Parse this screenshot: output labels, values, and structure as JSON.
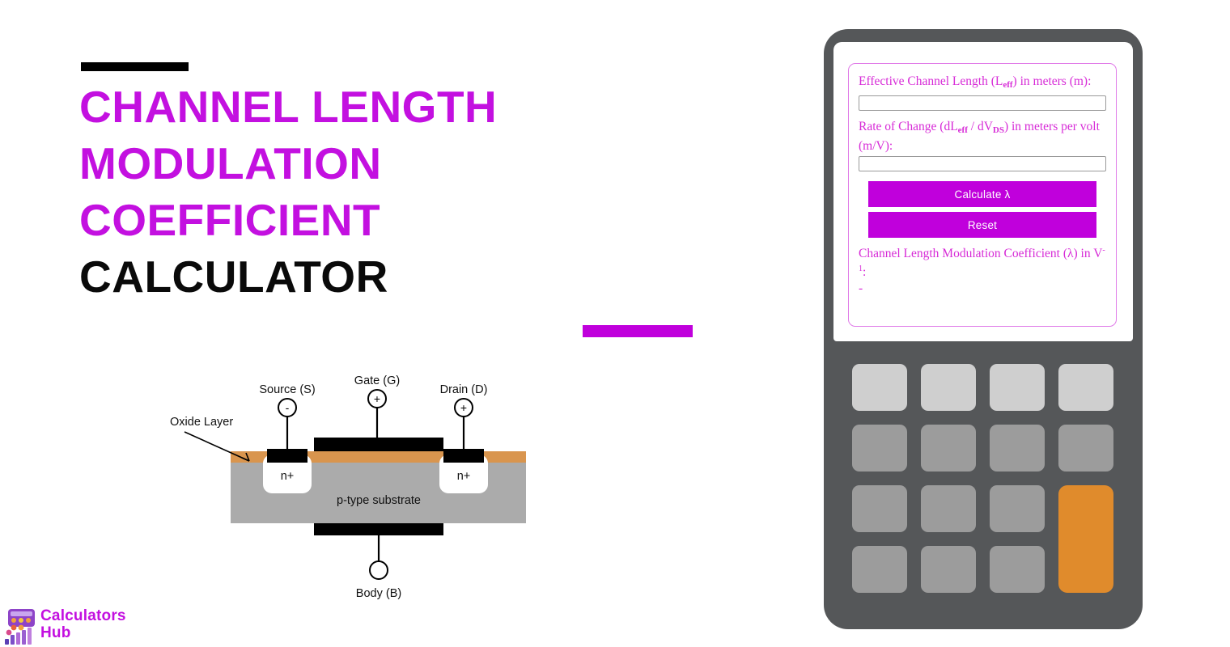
{
  "hero": {
    "title_line1": "CHANNEL LENGTH",
    "title_line2": "MODULATION",
    "title_line3": "COEFFICIENT",
    "title_line4": "CALCULATOR",
    "accent_purple": "#C310E0",
    "accent_black": "#000000"
  },
  "diagram": {
    "name": "mosfet-cross-section",
    "labels": {
      "oxide_layer": "Oxide Layer",
      "source": "Source (S)",
      "gate": "Gate (G)",
      "drain": "Drain (D)",
      "body": "Body (B)",
      "substrate": "p-type substrate",
      "n_plus_left": "n+",
      "n_plus_right": "n+",
      "source_sign": "-",
      "gate_sign": "+",
      "drain_sign": "+"
    },
    "colors": {
      "oxide": "#D9954E",
      "substrate": "#ABABAB",
      "electrode": "#000000",
      "well": "#FFFFFF"
    }
  },
  "logo": {
    "text_line1": "Calculators",
    "text_line2": "Hub",
    "icon": "calculator-bars-icon",
    "color": "#C310E0"
  },
  "calculator": {
    "frame_color": "#555759",
    "screen_color": "#FFFFFF",
    "form": {
      "field1": {
        "label_pre": "Effective Channel Length (L",
        "label_sub": "eff",
        "label_post": ") in meters (m):",
        "value": "",
        "placeholder": ""
      },
      "field2": {
        "label_p1": "Rate of Change (dL",
        "label_sub1": "eff",
        "label_p2": " / dV",
        "label_sub2": "DS",
        "label_p3": ") in meters per volt (m/V):",
        "value": "",
        "placeholder": ""
      },
      "calculate_label": "Calculate λ",
      "reset_label": "Reset",
      "result_label_pre": "Channel Length Modulation Coefficient (λ) in V",
      "result_label_sup": "-1",
      "result_label_post": ":",
      "result_value": "-",
      "button_color": "#C000DC",
      "label_color": "#D72BD7"
    },
    "keypad": {
      "rows": [
        [
          {
            "style": "light",
            "label": ""
          },
          {
            "style": "light",
            "label": ""
          },
          {
            "style": "light",
            "label": ""
          },
          {
            "style": "light",
            "label": ""
          }
        ],
        [
          {
            "style": "gray",
            "label": ""
          },
          {
            "style": "gray",
            "label": ""
          },
          {
            "style": "gray",
            "label": ""
          },
          {
            "style": "gray",
            "label": ""
          }
        ],
        [
          {
            "style": "gray",
            "label": ""
          },
          {
            "style": "gray",
            "label": ""
          },
          {
            "style": "gray",
            "label": ""
          },
          {
            "style": "orange",
            "label": ""
          }
        ],
        [
          {
            "style": "gray",
            "label": ""
          },
          {
            "style": "gray",
            "label": ""
          },
          {
            "style": "gray",
            "label": ""
          }
        ]
      ],
      "key_color": "#9C9C9C",
      "light_key_color": "#CFCFCF",
      "accent_key_color": "#E08B2C"
    }
  }
}
